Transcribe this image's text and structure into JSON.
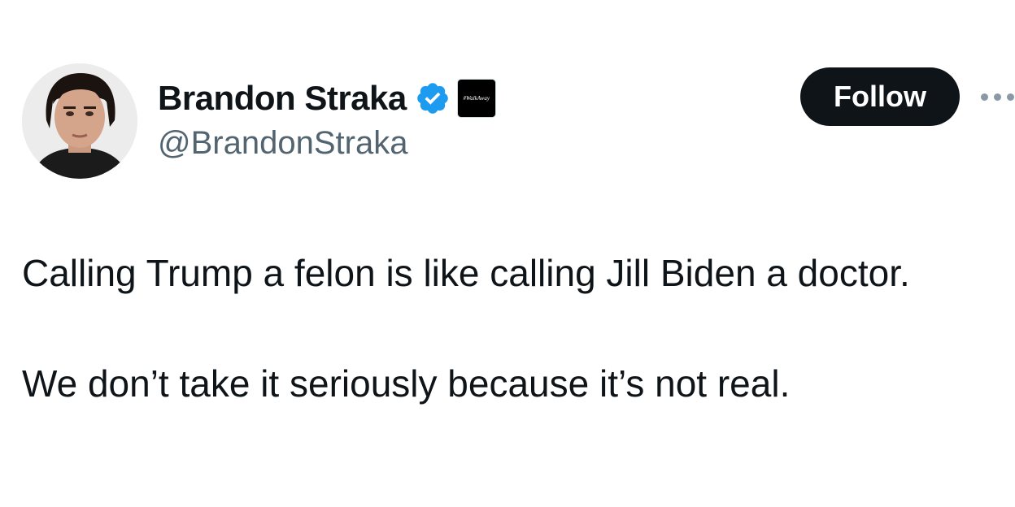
{
  "author": {
    "display_name": "Brandon Straka",
    "handle": "@BrandonStraka",
    "verified": true,
    "affiliate_badge_text": "#WalkAway"
  },
  "actions": {
    "follow_label": "Follow",
    "more_icon": "more-horizontal-icon"
  },
  "tweet": {
    "paragraphs": [
      "Calling Trump a felon is like calling Jill Biden a doctor.",
      "We don’t take it seriously because it’s not real."
    ]
  },
  "colors": {
    "text_primary": "#0f1419",
    "text_secondary": "#536471",
    "verified_blue": "#1d9bf0",
    "follow_bg": "#0f1419",
    "follow_text": "#ffffff"
  }
}
